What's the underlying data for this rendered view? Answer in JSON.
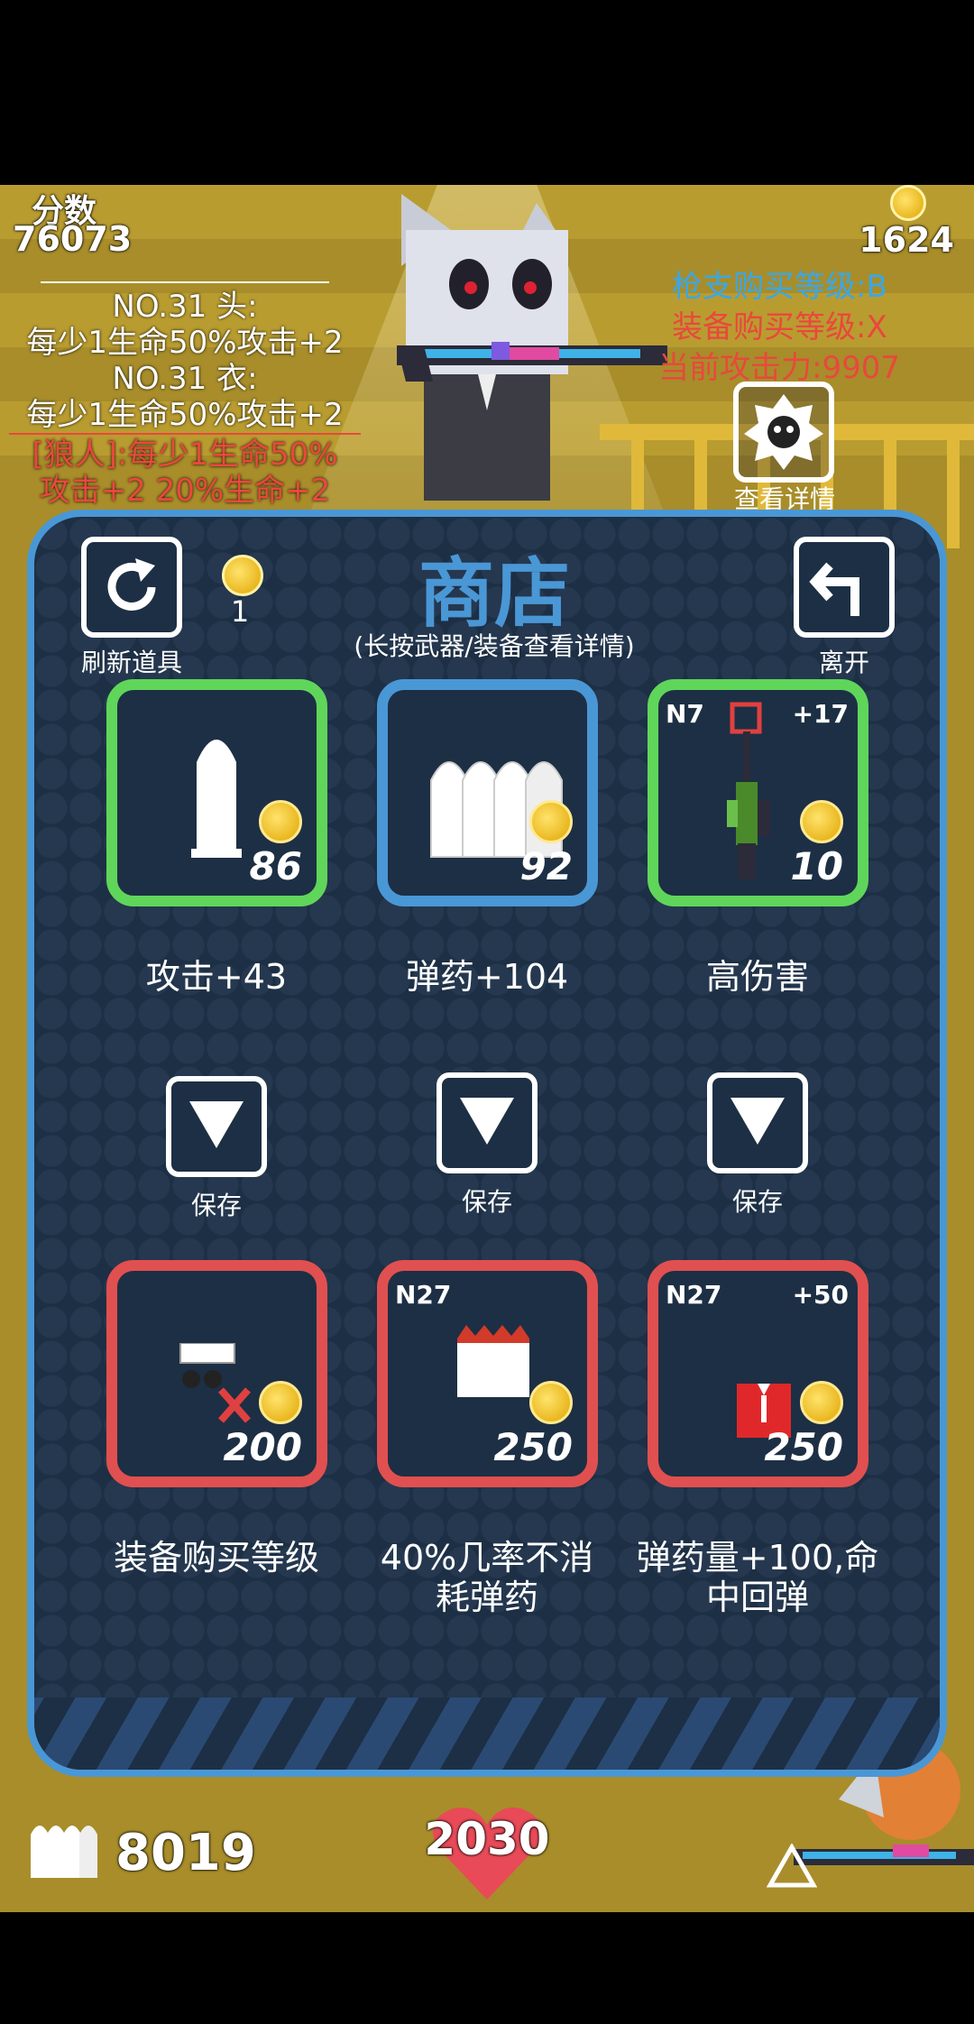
{
  "hud": {
    "score_label": "分数",
    "score_value": "76073",
    "coins": "1624",
    "gun_level": "枪支购买等级:B",
    "equip_level": "装备购买等级:X",
    "attack_power": "当前攻击力:9907",
    "view_details": "查看详情",
    "ammo_count": "8019",
    "health": "2030"
  },
  "equipment_info": {
    "head_title": "NO.31 头:",
    "head_effect": "每少1生命50%攻击+2",
    "body_title": "NO.31 衣:",
    "body_effect": "每少1生命50%攻击+2",
    "set_line1": "[狼人]:每少1生命50%",
    "set_line2": "攻击+2 20%生命+2"
  },
  "shop": {
    "title": "商店",
    "subtitle": "(长按武器/装备查看详情)",
    "refresh_label": "刷新道具",
    "refresh_cost": "1",
    "leave_label": "离开",
    "save_label": "保存",
    "top_items": [
      {
        "price": "86",
        "label": "攻击+43",
        "tag_left": "",
        "tag_right": "",
        "border": "#5fd65a"
      },
      {
        "price": "92",
        "label": "弹药+104",
        "tag_left": "",
        "tag_right": "",
        "border": "#4a97d6"
      },
      {
        "price": "10",
        "label": "高伤害",
        "tag_left": "N7",
        "tag_right": "+17",
        "border": "#5fd65a"
      }
    ],
    "bottom_items": [
      {
        "price": "200",
        "label": "装备购买等级",
        "tag_left": "",
        "tag_right": "",
        "border": "#e05050"
      },
      {
        "price": "250",
        "label": "40%几率不消耗弹药",
        "tag_left": "N27",
        "tag_right": "",
        "border": "#e05050"
      },
      {
        "price": "250",
        "label": "弹药量+100,命中回弹",
        "tag_left": "N27",
        "tag_right": "+50",
        "border": "#e05050"
      }
    ]
  },
  "colors": {
    "accent_blue": "#4a97d6",
    "green": "#5fd65a",
    "red": "#e05050",
    "gold": "#e0a500"
  }
}
